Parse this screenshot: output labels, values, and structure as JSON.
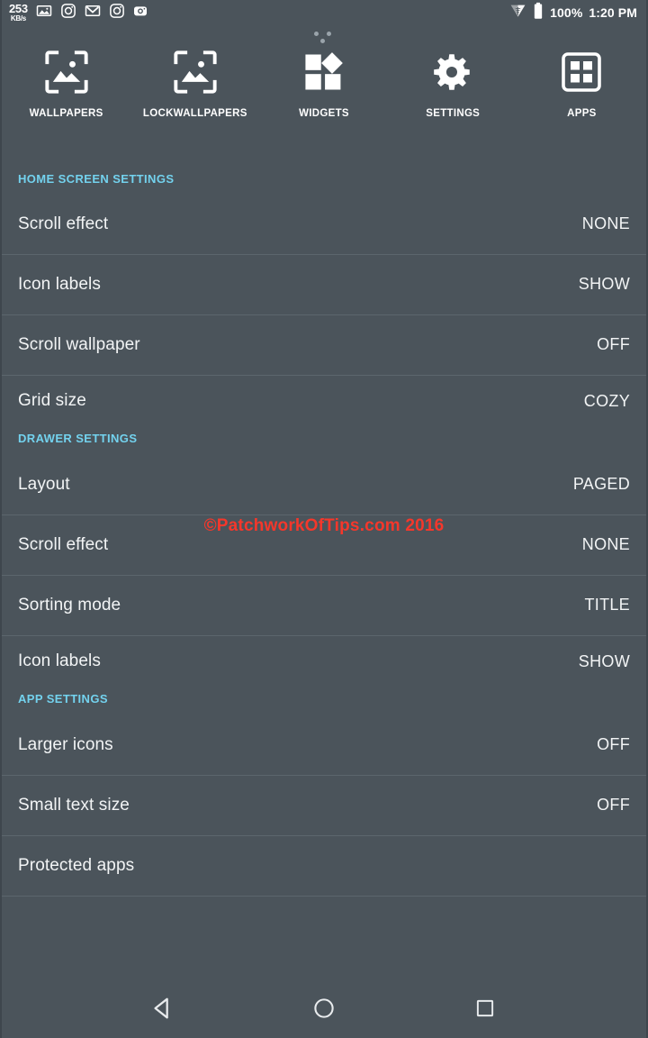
{
  "colors": {
    "background": "#4b545b",
    "divider": "#5c666d",
    "section_header": "#73d2ee",
    "primary_text": "#f2f4f5",
    "watermark": "#f5372b",
    "icon": "#ffffff"
  },
  "status_bar": {
    "network_speed_value": "253",
    "network_speed_unit": "KB/s",
    "notification_icons": [
      "gallery-image-icon",
      "instagram-icon",
      "gmail-icon",
      "instagram-icon",
      "camera-icon"
    ],
    "wifi_icon": "wifi-icon",
    "battery_icon": "battery-full-icon",
    "battery_percent": "100%",
    "clock": "1:20 PM"
  },
  "page_indicator": {
    "dots": 3
  },
  "toolbar": {
    "items": [
      {
        "label": "WALLPAPERS",
        "icon": "wallpapers-icon"
      },
      {
        "label": "LOCKWALLPAPERS",
        "icon": "lockwallpapers-icon"
      },
      {
        "label": "WIDGETS",
        "icon": "widgets-icon"
      },
      {
        "label": "SETTINGS",
        "icon": "settings-gear-icon"
      },
      {
        "label": "APPS",
        "icon": "apps-grid-icon"
      }
    ]
  },
  "settings": {
    "sections": [
      {
        "header": "HOME SCREEN SETTINGS",
        "rows": [
          {
            "label": "Scroll effect",
            "value": "NONE"
          },
          {
            "label": "Icon labels",
            "value": "SHOW"
          },
          {
            "label": "Scroll wallpaper",
            "value": "OFF"
          },
          {
            "label": "Grid size",
            "value": "COZY"
          }
        ]
      },
      {
        "header": "DRAWER SETTINGS",
        "rows": [
          {
            "label": "Layout",
            "value": "PAGED"
          },
          {
            "label": "Scroll effect",
            "value": "NONE"
          },
          {
            "label": "Sorting mode",
            "value": "TITLE"
          },
          {
            "label": "Icon labels",
            "value": "SHOW"
          }
        ]
      },
      {
        "header": "APP SETTINGS",
        "rows": [
          {
            "label": "Larger icons",
            "value": "OFF"
          },
          {
            "label": "Small text size",
            "value": "OFF"
          },
          {
            "label": "Protected apps",
            "value": ""
          }
        ]
      }
    ]
  },
  "watermark": {
    "text": "©PatchworkOfTips.com 2016"
  },
  "nav_bar": {
    "back": "back-triangle-icon",
    "home": "home-circle-icon",
    "recents": "recents-square-icon"
  }
}
